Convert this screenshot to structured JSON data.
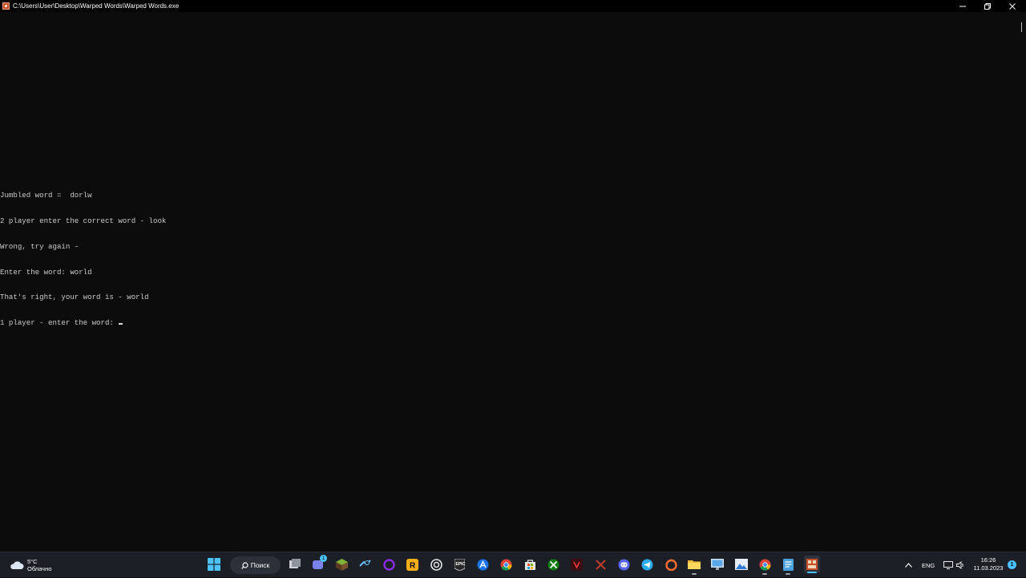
{
  "window": {
    "title": "C:\\Users\\User\\Desktop\\Warped Words\\Warped Words.exe",
    "icon": "console-app-icon",
    "controls": [
      "minimize-icon",
      "restore-icon",
      "close-icon"
    ]
  },
  "console": {
    "lines": [
      "Jumbled word =  dorlw",
      "2 player enter the correct word - look",
      "Wrong, try again -",
      "Enter the word: world",
      "That's right, your word is - world"
    ],
    "prompt": "1 player - enter the word: ",
    "background": "#0c0c0c",
    "text_color": "#cccccc"
  },
  "taskbar": {
    "weather": {
      "temperature": "5°C",
      "condition": "Облачно",
      "icon": "cloud-icon"
    },
    "search_label": "Поиск",
    "apps": [
      "windows-start-icon",
      "task-view-icon",
      "teams-chat-icon",
      "minecraft-icon",
      "steam-icon",
      "circle-app-icon",
      "rockstar-icon",
      "ubisoft-icon",
      "epic-games-icon",
      "app-store-icon",
      "chrome-icon",
      "microsoft-store-icon",
      "xbox-icon",
      "vivaldi-icon",
      "x-app-icon",
      "discord-icon",
      "telegram-icon",
      "origin-icon",
      "file-explorer-icon",
      "monitor-app-icon",
      "photos-icon",
      "chrome-profile-icon",
      "notepad-icon",
      "warped-words-icon"
    ],
    "chat_badge": "1",
    "tray": {
      "language": "ENG",
      "time": "16:26",
      "date": "11.03.2023",
      "notifications": "1"
    }
  },
  "colors": {
    "accent": "#4cc2ff",
    "taskbar": "#1c1f26",
    "titlebar": "#000000"
  }
}
